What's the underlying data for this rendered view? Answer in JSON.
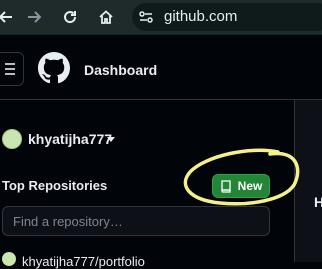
{
  "browser": {
    "url": "github.com",
    "icons": [
      "back-arrow-icon",
      "forward-arrow-icon",
      "reload-icon",
      "home-icon",
      "site-settings-icon"
    ]
  },
  "header": {
    "title": "Dashboard",
    "icons": [
      "hamburger-menu-icon",
      "github-logo-icon"
    ]
  },
  "user": {
    "name": "khyatijha777"
  },
  "repositories": {
    "heading": "Top Repositories",
    "new_button": "New",
    "search_placeholder": "Find a repository…",
    "items": [
      {
        "name": "khyatijha777/portfolio"
      }
    ]
  },
  "right_panel": {
    "fragment": "H"
  },
  "colors": {
    "page_bg": "#010409",
    "new_button_bg": "#238636",
    "annotation_ring": "#f6f08a"
  }
}
